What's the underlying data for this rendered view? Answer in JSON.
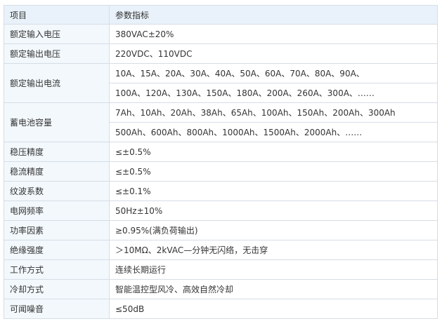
{
  "header": {
    "item": "项目",
    "value": "参数指标"
  },
  "rows": [
    {
      "item": "额定输入电压",
      "values": [
        "380VAC±20%"
      ]
    },
    {
      "item": "额定输出电压",
      "values": [
        "220VDC、110VDC"
      ]
    },
    {
      "item": "额定输出电流",
      "values": [
        "10A、15A、20A、30A、40A、50A、60A、70A、80A、90A、",
        "100A、120A、130A、150A、180A、200A、260A、300A、……"
      ]
    },
    {
      "item": "蓄电池容量",
      "values": [
        "7Ah、10Ah、20Ah、38Ah、65Ah、100Ah、150Ah、200Ah、300Ah",
        "500Ah、600Ah、800Ah、1000Ah、1500Ah、2000Ah、……"
      ]
    },
    {
      "item": "稳压精度",
      "values": [
        "≤±0.5%"
      ]
    },
    {
      "item": "稳流精度",
      "values": [
        "≤±0.5%"
      ]
    },
    {
      "item": "纹波系数",
      "values": [
        "≤±0.1%"
      ]
    },
    {
      "item": "电网频率",
      "values": [
        "50Hz±10%"
      ]
    },
    {
      "item": "功率因素",
      "values": [
        "≥0.95%(满负荷输出)"
      ]
    },
    {
      "item": "绝缘强度",
      "values": [
        "＞10MΩ、2kVAC—分钟无闪络，无击穿"
      ]
    },
    {
      "item": "工作方式",
      "values": [
        "连续长期运行"
      ]
    },
    {
      "item": "冷却方式",
      "values": [
        "智能温控型风冷、高效自然冷却"
      ]
    },
    {
      "item": "可闻噪音",
      "values": [
        "≤50dB"
      ]
    }
  ]
}
